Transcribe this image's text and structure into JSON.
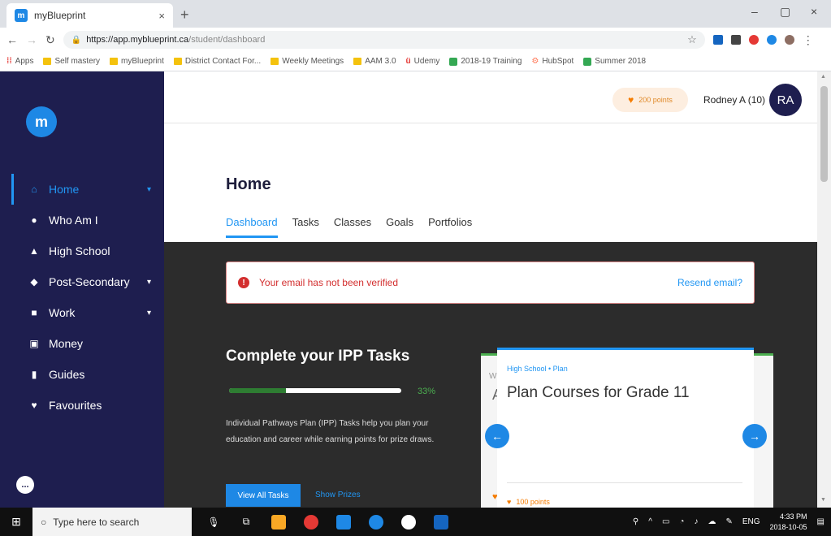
{
  "browser": {
    "tab_title": "myBlueprint",
    "tab_close": "×",
    "new_tab": "+",
    "url_host": "https://app.myblueprint.ca",
    "url_path": "/student/dashboard",
    "win_minimize": "–",
    "win_maximize": "▢",
    "win_close": "×",
    "bookmarks": [
      {
        "label": "Apps"
      },
      {
        "label": "Self mastery"
      },
      {
        "label": "myBlueprint"
      },
      {
        "label": "District Contact For..."
      },
      {
        "label": "Weekly Meetings"
      },
      {
        "label": "AAM 3.0"
      },
      {
        "label": "Udemy"
      },
      {
        "label": "2018-19 Training"
      },
      {
        "label": "HubSpot"
      },
      {
        "label": "Summer 2018"
      }
    ]
  },
  "header": {
    "points": "200 points",
    "user_name": "Rodney A (10)",
    "avatar_initials": "RA"
  },
  "sidebar": {
    "logo": "m",
    "items": [
      {
        "label": "Home",
        "icon": "home-icon",
        "glyph": "⌂",
        "has_chevron": true
      },
      {
        "label": "Who Am I",
        "icon": "person-circle-icon",
        "glyph": "●",
        "has_chevron": false
      },
      {
        "label": "High School",
        "icon": "school-icon",
        "glyph": "▲",
        "has_chevron": false
      },
      {
        "label": "Post-Secondary",
        "icon": "graduation-cap-icon",
        "glyph": "◆",
        "has_chevron": true
      },
      {
        "label": "Work",
        "icon": "briefcase-icon",
        "glyph": "■",
        "has_chevron": true
      },
      {
        "label": "Money",
        "icon": "money-icon",
        "glyph": "▣",
        "has_chevron": false
      },
      {
        "label": "Guides",
        "icon": "book-icon",
        "glyph": "▮",
        "has_chevron": false
      },
      {
        "label": "Favourites",
        "icon": "heart-icon",
        "glyph": "♥",
        "has_chevron": false
      }
    ],
    "chat": "..."
  },
  "page": {
    "title": "Home",
    "tabs": [
      "Dashboard",
      "Tasks",
      "Classes",
      "Goals",
      "Portfolios"
    ],
    "active_tab": "Dashboard"
  },
  "alert": {
    "message": "Your email has not been verified",
    "action": "Resend email?"
  },
  "ipp": {
    "title": "Complete your IPP Tasks",
    "progress_percent": 33,
    "progress_label": "33%",
    "description": "Individual Pathways Plan (IPP) Tasks help you plan your education and career while earning points for prize draws.",
    "view_all": "View All Tasks",
    "show_prizes": "Show Prizes"
  },
  "task_card": {
    "kicker": "High School • Plan",
    "title": "Plan Courses for Grade 11",
    "points": "100 points",
    "ghost_kicker": "W",
    "ghost_title": "A"
  },
  "taskbar": {
    "search_placeholder": "Type here to search",
    "lang": "ENG",
    "time": "4:33 PM",
    "date": "2018-10-05"
  },
  "colors": {
    "sidebar_bg": "#1e1e4f",
    "accent": "#2196f3",
    "content_bg": "#2c2c2c",
    "progress": "#2e7d32",
    "alert_text": "#d32f2f",
    "points": "#f57c00"
  }
}
